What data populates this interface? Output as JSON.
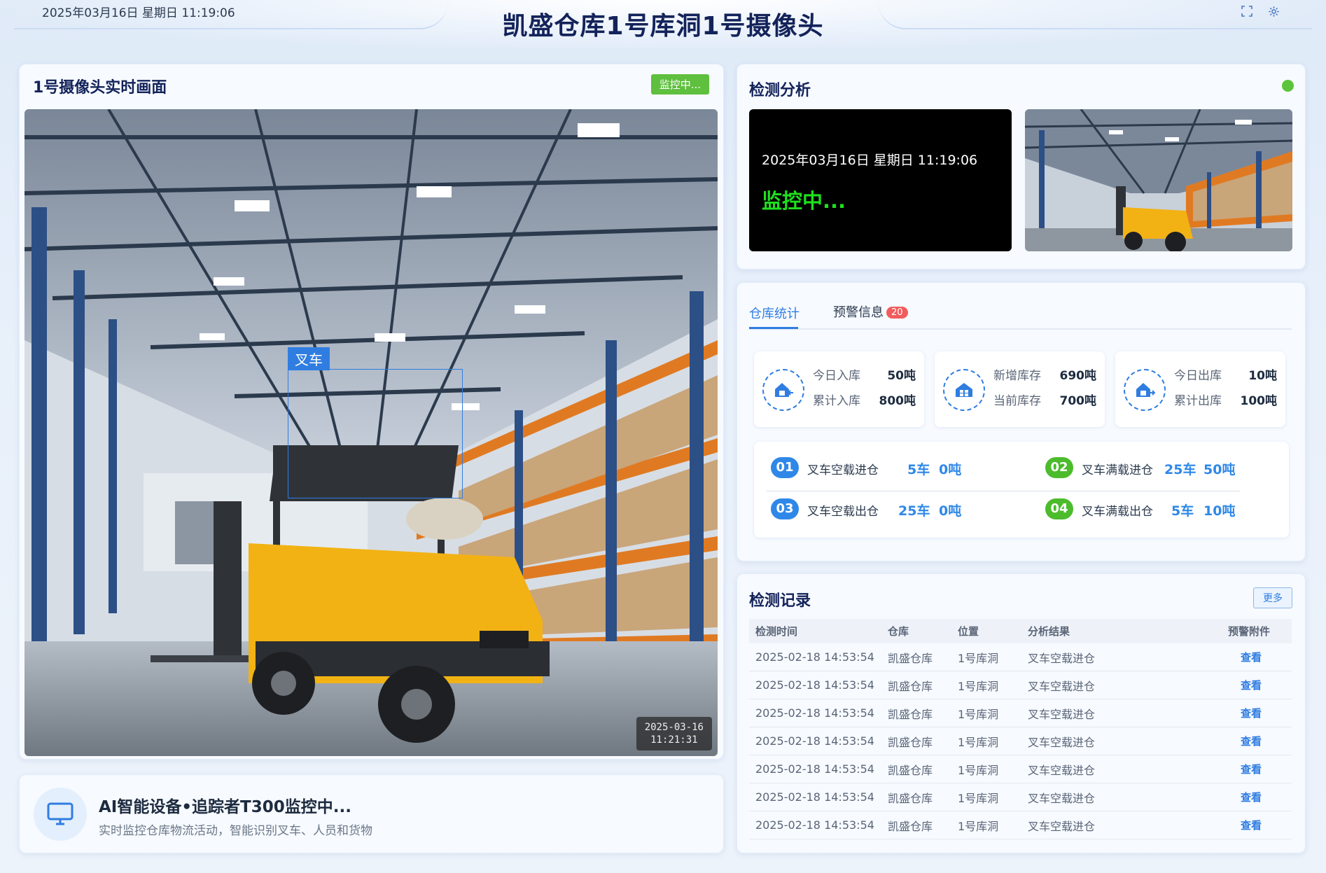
{
  "header": {
    "datetime": "2025年03月16日 星期日 11:19:06",
    "title": "凯盛仓库1号库洞1号摄像头"
  },
  "video": {
    "title": "1号摄像头实时画面",
    "badge": "监控中...",
    "detection_label": "叉车",
    "timestamp_date": "2025-03-16",
    "timestamp_time": "11:21:31"
  },
  "ai_device": {
    "title": "AI智能设备•追踪者T300监控中...",
    "subtitle": "实时监控仓库物流活动，智能识别叉车、人员和货物"
  },
  "analysis": {
    "title": "检测分析",
    "screen_time": "2025年03月16日 星期日 11:19:06",
    "screen_status": "监控中..."
  },
  "stats": {
    "tabs": [
      {
        "label": "仓库统计"
      },
      {
        "label": "预警信息",
        "badge": "20"
      }
    ],
    "boxes": [
      {
        "row1_label": "今日入库",
        "row1_value": "50吨",
        "row2_label": "累计入库",
        "row2_value": "800吨"
      },
      {
        "row1_label": "新增库存",
        "row1_value": "690吨",
        "row2_label": "当前库存",
        "row2_value": "700吨"
      },
      {
        "row1_label": "今日出库",
        "row1_value": "10吨",
        "row2_label": "累计出库",
        "row2_value": "100吨"
      }
    ],
    "flows": [
      {
        "num": "01",
        "label": "叉车空载进仓",
        "cars": "5车",
        "tons": "0吨",
        "color": "#2f88e8"
      },
      {
        "num": "02",
        "label": "叉车满载进仓",
        "cars": "25车",
        "tons": "50吨",
        "color": "#4cbb2c"
      },
      {
        "num": "03",
        "label": "叉车空载出仓",
        "cars": "25车",
        "tons": "0吨",
        "color": "#2f88e8"
      },
      {
        "num": "04",
        "label": "叉车满载出仓",
        "cars": "5车",
        "tons": "10吨",
        "color": "#4cbb2c"
      }
    ]
  },
  "records": {
    "title": "检测记录",
    "more": "更多",
    "columns": [
      "检测时间",
      "仓库",
      "位置",
      "分析结果",
      "预警附件"
    ],
    "rows": [
      [
        "2025-02-18 14:53:54",
        "凯盛仓库",
        "1号库洞",
        "叉车空载进仓",
        "查看"
      ],
      [
        "2025-02-18 14:53:54",
        "凯盛仓库",
        "1号库洞",
        "叉车空载进仓",
        "查看"
      ],
      [
        "2025-02-18 14:53:54",
        "凯盛仓库",
        "1号库洞",
        "叉车空载进仓",
        "查看"
      ],
      [
        "2025-02-18 14:53:54",
        "凯盛仓库",
        "1号库洞",
        "叉车空载进仓",
        "查看"
      ],
      [
        "2025-02-18 14:53:54",
        "凯盛仓库",
        "1号库洞",
        "叉车空载进仓",
        "查看"
      ],
      [
        "2025-02-18 14:53:54",
        "凯盛仓库",
        "1号库洞",
        "叉车空载进仓",
        "查看"
      ],
      [
        "2025-02-18 14:53:54",
        "凯盛仓库",
        "1号库洞",
        "叉车空载进仓",
        "查看"
      ]
    ]
  },
  "icons": [
    "fullscreen-icon",
    "settings-icon",
    "monitor-icon",
    "warehouse-in-icon",
    "warehouse-stock-icon",
    "warehouse-out-icon"
  ],
  "colors": {
    "accent": "#2f7de1",
    "live": "#5fbf3f",
    "status_ok": "#5bc43c",
    "alert_badge": "#f25c5c"
  }
}
